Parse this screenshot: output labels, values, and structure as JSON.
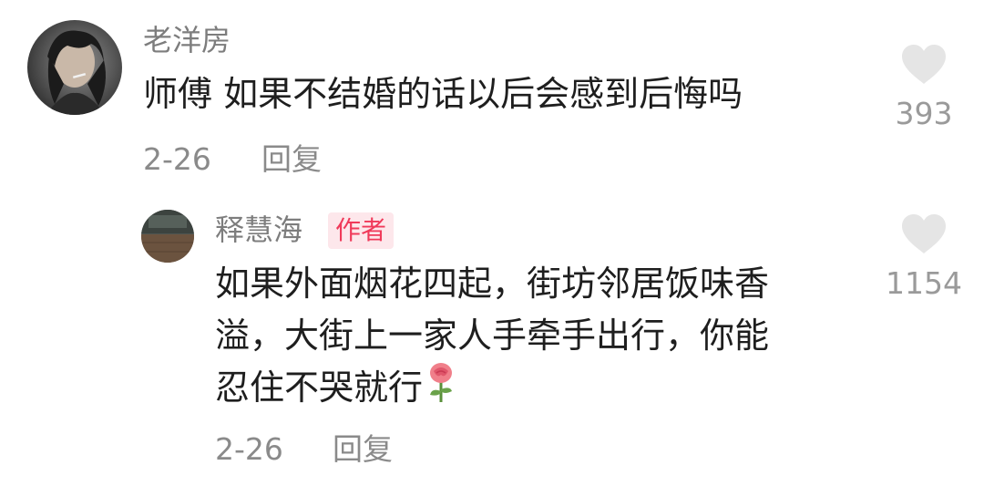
{
  "comment": {
    "username": "老洋房",
    "text": "师傅 如果不结婚的话以后会感到后悔吗",
    "date": "2-26",
    "reply_label": "回复",
    "like_count": "393",
    "avatar_icon": "user-portrait-avatar"
  },
  "reply": {
    "username": "释慧海",
    "badge": "作者",
    "lines": [
      "如果外面烟花四起，街坊邻居饭味香",
      "溢，大街上一家人手牵手出行，你能",
      "忍住不哭就行"
    ],
    "emoji": "rose-icon",
    "date": "2-26",
    "reply_label": "回复",
    "like_count": "1154",
    "avatar_icon": "user-avatar"
  },
  "colors": {
    "badge_text": "#f03a5a",
    "badge_bg": "#fde7eb",
    "heart": "#e5e5e5",
    "meta_text": "#8a8a8a"
  }
}
